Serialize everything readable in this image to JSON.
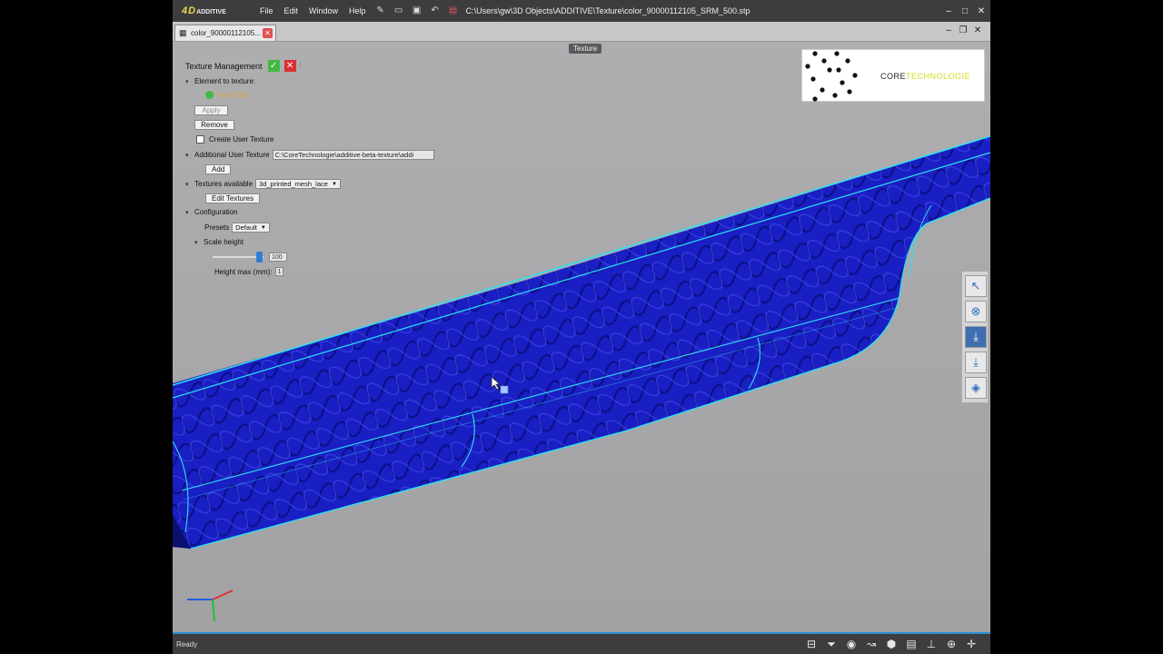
{
  "titlebar": {
    "app_logo": "4D",
    "app_logo_sub": "ADDITIVE",
    "menu": [
      "File",
      "Edit",
      "Window",
      "Help"
    ],
    "file_path": "C:\\Users\\gw\\3D Objects\\ADDITIVE\\Texture\\color_90000112105_SRM_500.stp",
    "icons": [
      "pin-icon",
      "open-icon",
      "save-icon",
      "undo-icon",
      "pdf-icon"
    ]
  },
  "tab": {
    "label": "color_90000112105..."
  },
  "viewport": {
    "mode_label": "Texture"
  },
  "panel": {
    "title": "Texture Management",
    "element_to_texture": "Element to texture:",
    "face_label": "Face (53)",
    "apply": "Apply",
    "remove": "Remove",
    "create_user_texture": "Create User Texture",
    "additional_user_texture": "Additional User Texture",
    "additional_path": "C:\\CoreTechnologie\\additive-beta-texture\\addi",
    "add": "Add",
    "textures_available": "Textures available",
    "texture_selected": "3d_printed_mesh_lace",
    "edit_textures": "Edit Textures",
    "configuration": "Configuration",
    "presets": "Presets",
    "preset_selected": "Default",
    "scale_height": "Scale height",
    "scale_value": "100",
    "height_max_label": "Height max (mm):",
    "height_max_value": "1"
  },
  "brand": {
    "text_a": "CORE",
    "text_b": "TECHNOLOGIE"
  },
  "right_toolbar": [
    "select-icon",
    "cancel-circle-icon",
    "import-icon",
    "export-icon",
    "view-cube-icon"
  ],
  "statusbar": {
    "status": "Ready"
  },
  "colors": {
    "model_fill": "#1a1ec8",
    "edge_highlight": "#30e0f0",
    "accent": "#2b8fd0"
  }
}
